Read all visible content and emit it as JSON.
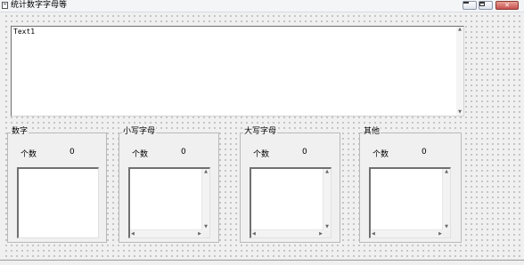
{
  "window": {
    "title": "统计数字字母等",
    "icon": "form-icon",
    "controls": {
      "minimize": "minimize-icon",
      "maximize": "maximize-icon",
      "close": "close-icon",
      "close_glyph": "✕"
    }
  },
  "textbox": {
    "value": "Text1"
  },
  "frames": [
    {
      "caption": "数字",
      "count_label": "个数",
      "count_value": "0"
    },
    {
      "caption": "小写字母",
      "count_label": "个数",
      "count_value": "0"
    },
    {
      "caption": "大写字母",
      "count_label": "个数",
      "count_value": "0"
    },
    {
      "caption": "其他",
      "count_label": "个数",
      "count_value": "0"
    }
  ],
  "glyphs": {
    "up": "▲",
    "down": "▼",
    "left": "◀",
    "right": "▶"
  }
}
